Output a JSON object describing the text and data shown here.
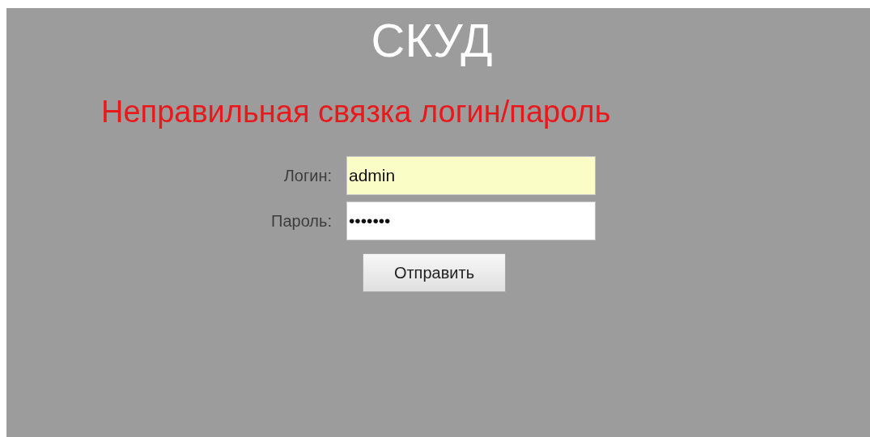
{
  "title": "СКУД",
  "error": "Неправильная связка логин/пароль",
  "fields": [
    {
      "label": "Логин:",
      "value": "admin",
      "autofilled": true
    },
    {
      "label": "Пароль:",
      "value": "•••••••",
      "autofilled": false
    }
  ],
  "submit": "Отправить"
}
